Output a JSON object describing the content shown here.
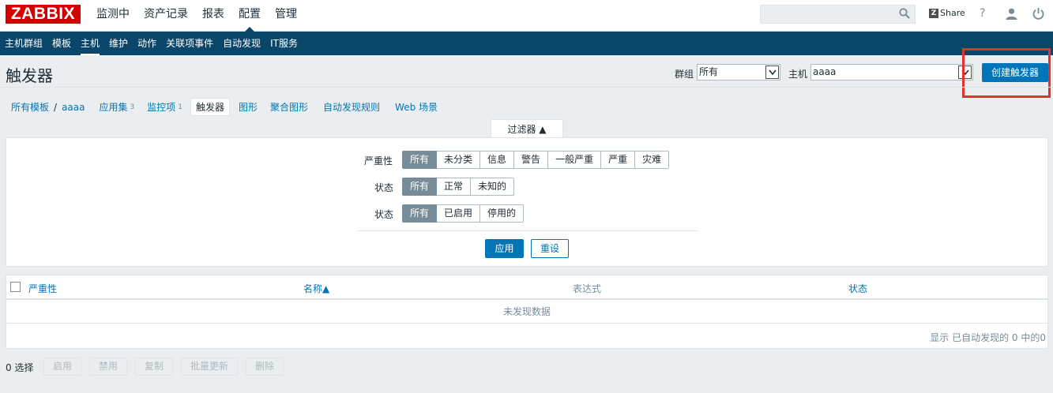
{
  "logo": "ZABBIX",
  "main_menu": [
    "监测中",
    "资产记录",
    "报表",
    "配置",
    "管理"
  ],
  "main_menu_active": "配置",
  "search": {
    "value": "",
    "placeholder": ""
  },
  "share_label": "Share",
  "help_label": "?",
  "sub_menu": [
    "主机群组",
    "模板",
    "主机",
    "维护",
    "动作",
    "关联项事件",
    "自动发现",
    "IT服务"
  ],
  "sub_menu_active": "主机",
  "page_title": "触发器",
  "group_label": "群组",
  "group_value": "所有",
  "host_label": "主机",
  "host_value": "aaaa",
  "create_button": "创建触发器",
  "breadcrumbs": {
    "all_templates": "所有模板",
    "separator": "/",
    "host": "aaaa",
    "applications": "应用集",
    "applications_count": "3",
    "items": "监控项",
    "items_count": "1",
    "triggers": "触发器",
    "graphs": "图形",
    "screens": "聚合图形",
    "discovery": "自动发现规则",
    "web": "Web 场景"
  },
  "filter": {
    "tab_label": "过滤器 ▲",
    "severity_label": "严重性",
    "severity_options": [
      "所有",
      "未分类",
      "信息",
      "警告",
      "一般严重",
      "严重",
      "灾难"
    ],
    "severity_selected": "所有",
    "state_label": "状态",
    "state_options": [
      "所有",
      "正常",
      "未知的"
    ],
    "status_label": "状态",
    "status_options": [
      "所有",
      "已启用",
      "停用的"
    ],
    "apply": "应用",
    "reset": "重设"
  },
  "table": {
    "columns": [
      "严重性",
      "名称▲",
      "表达式",
      "状态"
    ],
    "empty_message": "未发现数据",
    "paging": "显示 已自动发现的 0 中的0"
  },
  "actions": {
    "selected": "0 选择",
    "buttons": [
      "启用",
      "禁用",
      "复制",
      "批量更新",
      "删除"
    ]
  },
  "colors": {
    "logo_red": "#d40000",
    "nav_blue": "#0a466a",
    "link_blue": "#0275b8",
    "highlight_red": "#e52f31"
  }
}
